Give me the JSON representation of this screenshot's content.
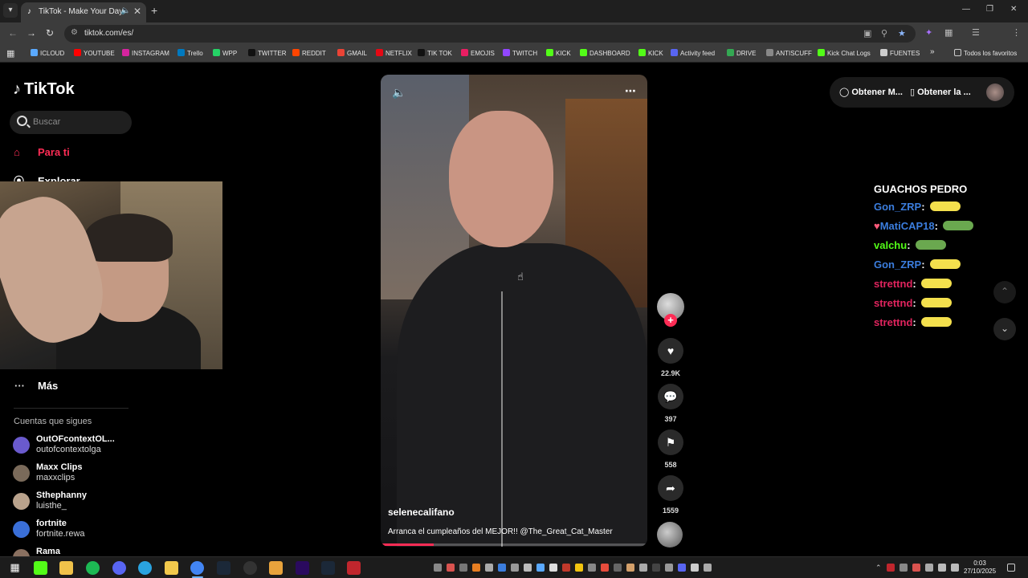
{
  "browser": {
    "tab": {
      "title": "TikTok - Make Your Day",
      "favicon": "tiktok-icon",
      "audio_icon": "speaker-icon"
    },
    "address": "tiktok.com/es/",
    "bookmarks": [
      {
        "label": "ICLOUD",
        "color": "#5aa9ff"
      },
      {
        "label": "YOUTUBE",
        "color": "#ff0000"
      },
      {
        "label": "INSTAGRAM",
        "color": "#d6249f"
      },
      {
        "label": "Trello",
        "color": "#0079bf"
      },
      {
        "label": "WPP",
        "color": "#25d366"
      },
      {
        "label": "TWITTER",
        "color": "#111111"
      },
      {
        "label": "REDDIT",
        "color": "#ff4500"
      },
      {
        "label": "GMAIL",
        "color": "#ea4335"
      },
      {
        "label": "NETFLIX",
        "color": "#e50914"
      },
      {
        "label": "TIK TOK",
        "color": "#111111"
      },
      {
        "label": "EMOJIS",
        "color": "#e91e63"
      },
      {
        "label": "TWITCH",
        "color": "#9146ff"
      },
      {
        "label": "KICK",
        "color": "#53fc18"
      },
      {
        "label": "DASHBOARD",
        "color": "#53fc18"
      },
      {
        "label": "KICK",
        "color": "#53fc18"
      },
      {
        "label": "Activity feed",
        "color": "#5865f2"
      },
      {
        "label": "DRIVE",
        "color": "#34a853"
      },
      {
        "label": "ANTISCUFF",
        "color": "#888888"
      },
      {
        "label": "Kick Chat Logs",
        "color": "#53fc18"
      },
      {
        "label": "FUENTES",
        "color": "#cccccc"
      }
    ],
    "all_bookmarks_label": "Todos los favoritos"
  },
  "sidebar": {
    "logo": "TikTok",
    "search_placeholder": "Buscar",
    "nav": [
      {
        "label": "Para ti",
        "icon": "home-icon",
        "active": true
      },
      {
        "label": "Explorar",
        "icon": "compass-icon",
        "active": false
      }
    ],
    "more_label": "Más",
    "following_heading": "Cuentas que sigues",
    "following": [
      {
        "name": "OutOFcontextOL...",
        "user": "outofcontextolga",
        "color": "#6a5acd"
      },
      {
        "name": "Maxx Clips",
        "user": "maxxclips",
        "color": "#7a6a5a"
      },
      {
        "name": "Sthephanny",
        "user": "luisthe_",
        "color": "#b9a28c"
      },
      {
        "name": "fortnite",
        "user": "fortnite.rewa",
        "color": "#3a6fd8"
      },
      {
        "name": "Rama",
        "user": "",
        "color": "#8a7060"
      }
    ]
  },
  "video": {
    "author": "selenecalifano",
    "caption": "Arranca el cumpleaños del MEJOR!! @The_Great_Cat_Master",
    "progress": 0.2,
    "likes": "22.9K",
    "comments": "397",
    "saves": "558",
    "shares": "1559"
  },
  "header": {
    "get_coins_label": "Obtener M...",
    "get_app_label": "Obtener la ..."
  },
  "chat": [
    {
      "user": "GUACHOS PEDRO",
      "color": "#ffffff",
      "emote": ""
    },
    {
      "user": "Gon_ZRP",
      "color": "#3b7ddd",
      "emote": "#f4e04d"
    },
    {
      "user": "MatiCAP18",
      "color": "#3b7ddd",
      "emote": "#6aa84f",
      "badge": "heart"
    },
    {
      "user": "valchu",
      "color": "#53fc18",
      "emote": "#6aa84f"
    },
    {
      "user": "Gon_ZRP",
      "color": "#3b7ddd",
      "emote": "#f4e04d"
    },
    {
      "user": "strettnd",
      "color": "#e0245e",
      "emote": "#f4e04d"
    },
    {
      "user": "strettnd",
      "color": "#e0245e",
      "emote": "#f4e04d"
    },
    {
      "user": "strettnd",
      "color": "#e0245e",
      "emote": "#f4e04d"
    }
  ],
  "taskbar": {
    "time": "0:03",
    "date": "27/10/2025"
  }
}
